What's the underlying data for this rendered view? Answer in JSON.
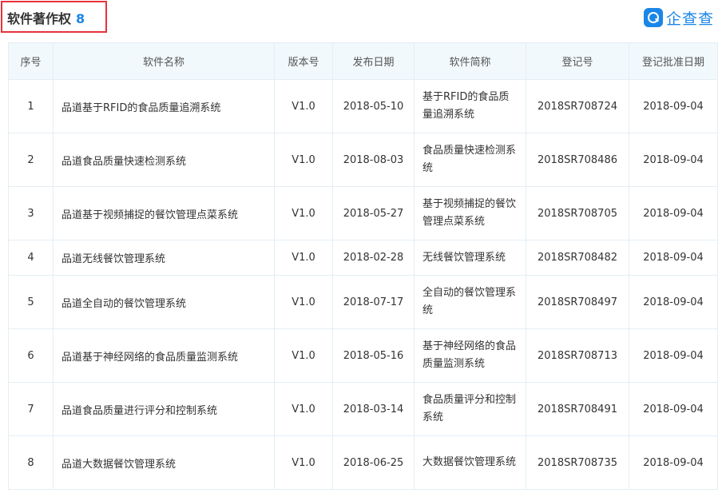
{
  "header": {
    "title": "软件著作权",
    "count": "8",
    "brand": "企查查"
  },
  "colors": {
    "accent": "#1a86e8",
    "highlight_border": "#e8323c",
    "header_bg": "#f2f9fc"
  },
  "table": {
    "headers": [
      "序号",
      "软件名称",
      "版本号",
      "发布日期",
      "软件简称",
      "登记号",
      "登记批准日期"
    ],
    "rows": [
      [
        "1",
        "品道基于RFID的食品质量追溯系统",
        "V1.0",
        "2018-05-10",
        "基于RFID的食品质量追溯系统",
        "2018SR708724",
        "2018-09-04"
      ],
      [
        "2",
        "品道食品质量快速检测系统",
        "V1.0",
        "2018-08-03",
        "食品质量快速检测系统",
        "2018SR708486",
        "2018-09-04"
      ],
      [
        "3",
        "品道基于视频捕捉的餐饮管理点菜系统",
        "V1.0",
        "2018-05-27",
        "基于视频捕捉的餐饮管理点菜系统",
        "2018SR708705",
        "2018-09-04"
      ],
      [
        "4",
        "品道无线餐饮管理系统",
        "V1.0",
        "2018-02-28",
        "无线餐饮管理系统",
        "2018SR708482",
        "2018-09-04"
      ],
      [
        "5",
        "品道全自动的餐饮管理系统",
        "V1.0",
        "2018-07-17",
        "全自动的餐饮管理系统",
        "2018SR708497",
        "2018-09-04"
      ],
      [
        "6",
        "品道基于神经网络的食品质量监测系统",
        "V1.0",
        "2018-05-16",
        "基于神经网络的食品质量监测系统",
        "2018SR708713",
        "2018-09-04"
      ],
      [
        "7",
        "品道食品质量进行评分和控制系统",
        "V1.0",
        "2018-03-14",
        "食品质量评分和控制系统",
        "2018SR708491",
        "2018-09-04"
      ],
      [
        "8",
        "品道大数据餐饮管理系统",
        "V1.0",
        "2018-06-25",
        "大数据餐饮管理系统",
        "2018SR708735",
        "2018-09-04"
      ]
    ]
  }
}
